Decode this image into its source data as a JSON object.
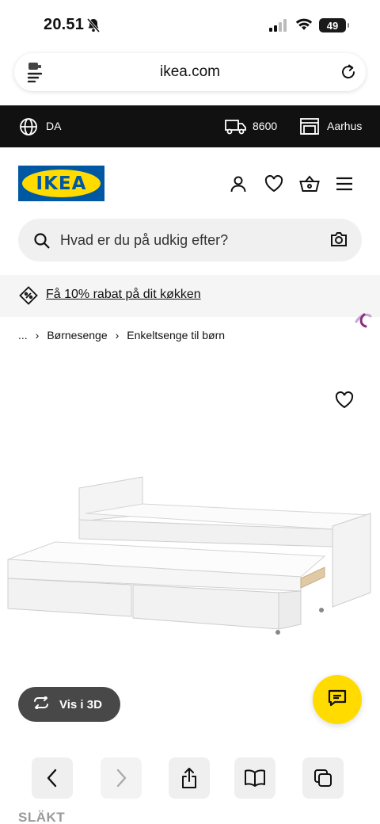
{
  "status_bar": {
    "time": "20.51",
    "battery": "49"
  },
  "browser": {
    "url": "ikea.com"
  },
  "topbar": {
    "language": "DA",
    "zip": "8600",
    "store": "Aarhus"
  },
  "header": {
    "logo_text": "IKEA",
    "colors": {
      "brand_blue": "#0058A3",
      "brand_yellow": "#FFDB00"
    }
  },
  "search": {
    "placeholder": "Hvad er du på udkig efter?"
  },
  "promo": {
    "link": "Få 10% rabat på dit køkken"
  },
  "breadcrumb": {
    "ellipsis": "...",
    "items": [
      "Børnesenge",
      "Enkeltsenge til børn"
    ]
  },
  "product": {
    "view_3d_label": "Vis i 3D",
    "series_name": "SLÄKT"
  },
  "icons": {
    "globe": "globe-icon",
    "truck": "truck-icon",
    "store": "store-icon",
    "profile": "profile-icon",
    "heart": "heart-icon",
    "basket": "basket-icon",
    "menu": "menu-icon",
    "search": "search-icon",
    "camera": "camera-icon",
    "tag": "tag-icon",
    "chat": "chat-icon",
    "rotate": "rotate-3d-icon"
  }
}
